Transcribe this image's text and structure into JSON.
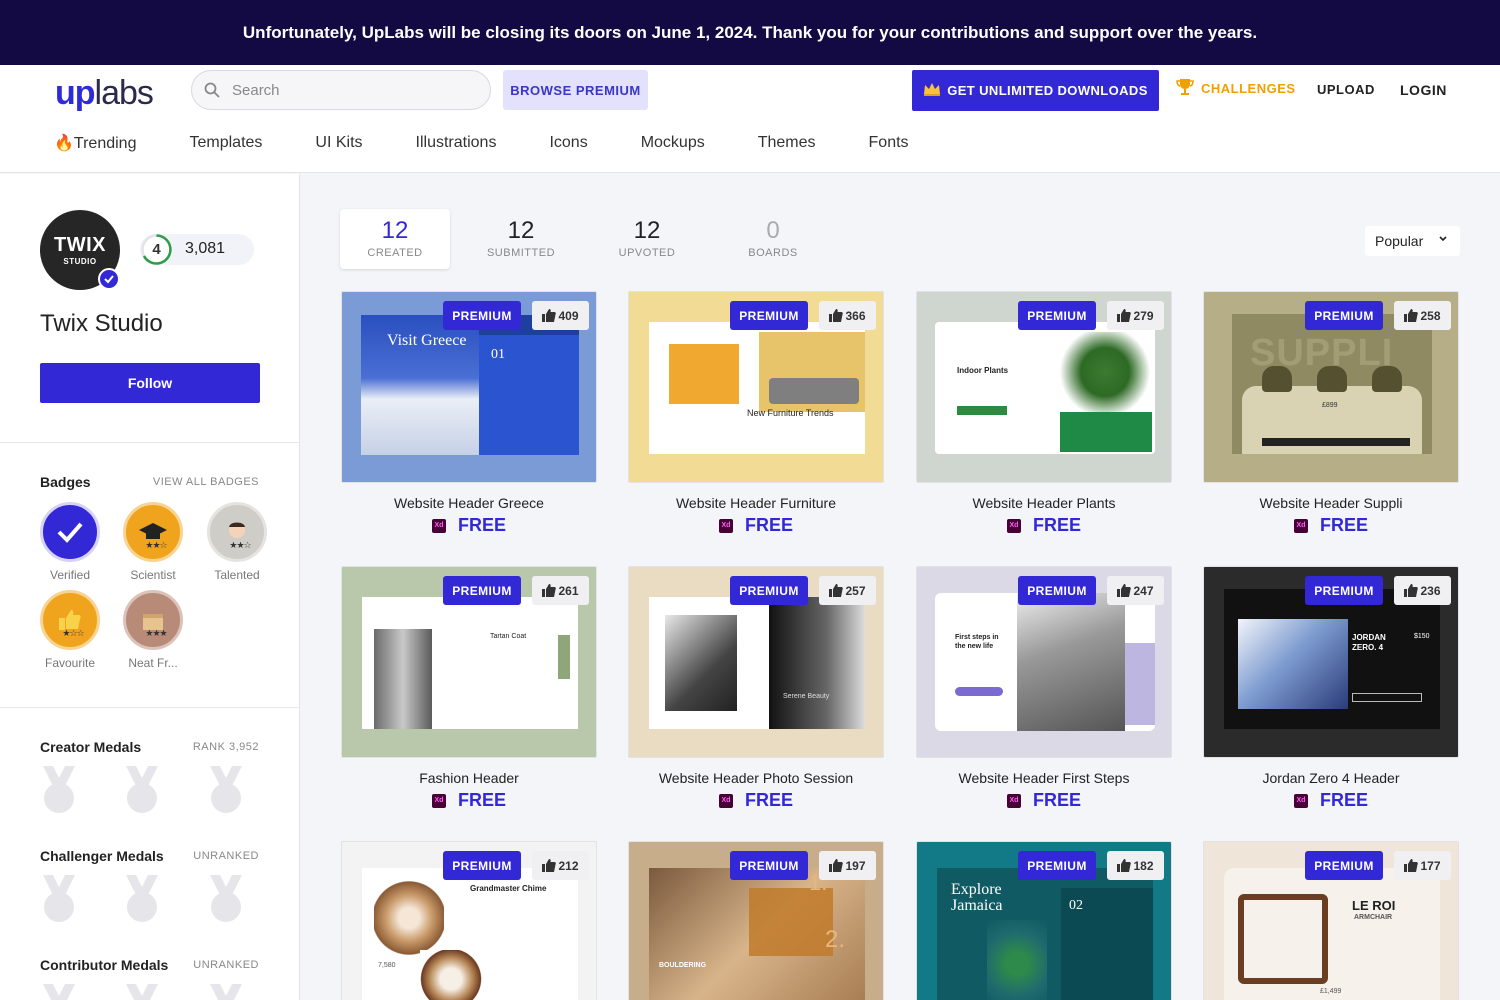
{
  "banner": {
    "text": "Unfortunately, UpLabs will be closing its doors on June 1, 2024. Thank you for your contributions and support over the years."
  },
  "header": {
    "logo_up": "up",
    "logo_labs": "labs",
    "search_placeholder": "Search",
    "browse_premium": "BROWSE PREMIUM",
    "unlimited": "GET UNLIMITED DOWNLOADS",
    "challenges": "CHALLENGES",
    "upload": "UPLOAD",
    "login": "LOGIN",
    "brand_color": "#3228d6",
    "categories": [
      "🔥Trending",
      "Templates",
      "UI Kits",
      "Illustrations",
      "Icons",
      "Mockups",
      "Themes",
      "Fonts"
    ]
  },
  "profile": {
    "avatar_line1": "TWIX",
    "avatar_line2": "STUDIO",
    "level": "4",
    "score": "3,081",
    "name": "Twix Studio",
    "follow": "Follow"
  },
  "badges": {
    "title": "Badges",
    "view_all": "VIEW ALL BADGES",
    "items": [
      {
        "label": "Verified",
        "icon": "check-icon"
      },
      {
        "label": "Scientist",
        "icon": "graduation-cap-icon"
      },
      {
        "label": "Talented",
        "icon": "person-icon"
      },
      {
        "label": "Favourite",
        "icon": "thumbs-up-icon"
      },
      {
        "label": "Neat Fr...",
        "icon": "box-icon"
      }
    ]
  },
  "medals": [
    {
      "title": "Creator Medals",
      "status": "RANK 3,952"
    },
    {
      "title": "Challenger Medals",
      "status": "UNRANKED"
    },
    {
      "title": "Contributor Medals",
      "status": "UNRANKED"
    }
  ],
  "stats": [
    {
      "value": "12",
      "label": "CREATED"
    },
    {
      "value": "12",
      "label": "SUBMITTED"
    },
    {
      "value": "12",
      "label": "UPVOTED"
    },
    {
      "value": "0",
      "label": "BOARDS"
    }
  ],
  "sort": "Popular",
  "card_badge": "PREMIUM",
  "card_price": "FREE",
  "cards": [
    {
      "title": "Website Header Greece",
      "likes": "409",
      "bg": "#7a9bd6"
    },
    {
      "title": "Website Header Furniture",
      "likes": "366",
      "bg": "#f2dc95"
    },
    {
      "title": "Website Header Plants",
      "likes": "279",
      "bg": "#cfd6d0"
    },
    {
      "title": "Website Header Suppli",
      "likes": "258",
      "bg": "#b6ae86"
    },
    {
      "title": "Fashion Header",
      "likes": "261",
      "bg": "#b9c7ab"
    },
    {
      "title": "Website Header Photo Session",
      "likes": "257",
      "bg": "#eadcc2"
    },
    {
      "title": "Website Header First Steps",
      "likes": "247",
      "bg": "#dcd9e6"
    },
    {
      "title": "Jordan Zero 4 Header",
      "likes": "236",
      "bg": "#2b2b2b"
    },
    {
      "title": "",
      "likes": "212",
      "bg": "#f3f3f3"
    },
    {
      "title": "",
      "likes": "197",
      "bg": "#c8ad8b"
    },
    {
      "title": "",
      "likes": "182",
      "bg": "#127a86"
    },
    {
      "title": "",
      "likes": "177",
      "bg": "#efe5d8"
    }
  ],
  "thumb_text": {
    "greece_title": "Visit Greece",
    "greece_num": "01",
    "furniture": "New Furniture Trends",
    "plants": "Indoor Plants",
    "suppli": "SUPPLI",
    "suppli_price": "£899",
    "fashion": "Tartan Coat",
    "photo": "Serene Beauty",
    "steps": "First steps in the new life",
    "jordan": "JORDAN ZERO. 4",
    "jordan_price": "$150",
    "watch": "Grandmaster Chime",
    "watch_price": "7,580",
    "climb": "BOULDERING",
    "climb_num1": "1.",
    "climb_num2": "2.",
    "jamaica": "Explore Jamaica",
    "jamaica_num": "02",
    "leroi": "LE ROI",
    "armchair": "ARMCHAIR",
    "leroi_price": "£1,499"
  }
}
